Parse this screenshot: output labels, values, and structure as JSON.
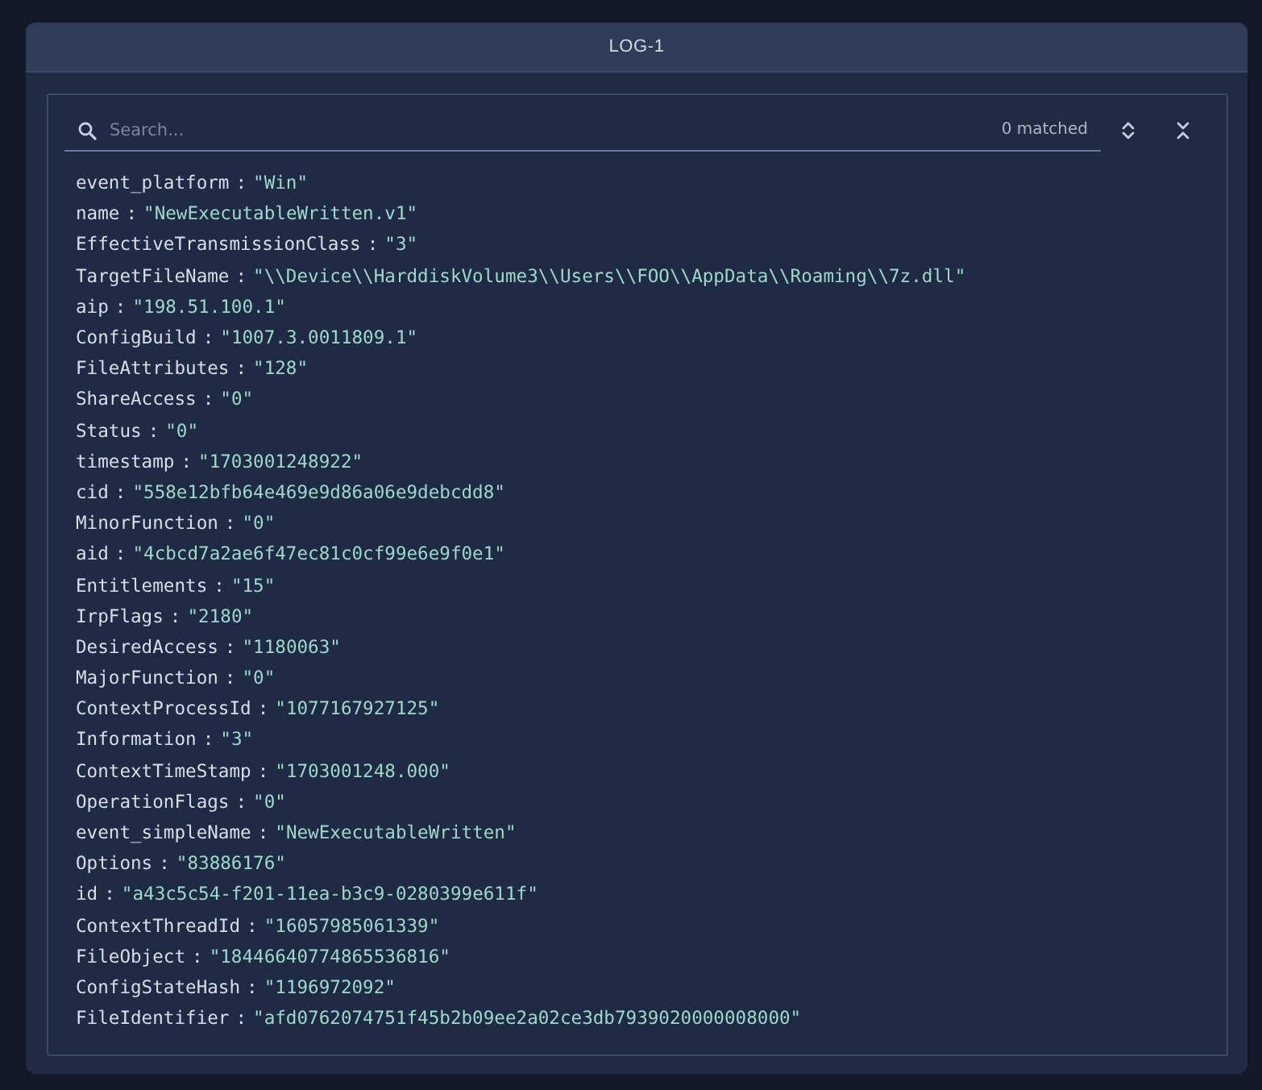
{
  "panel": {
    "title": "LOG-1"
  },
  "search": {
    "placeholder": "Search...",
    "match_count": "0 matched"
  },
  "fields": [
    {
      "key": "event_platform",
      "sep": ":",
      "value": "\"Win\""
    },
    {
      "key": "name",
      "sep": ":",
      "value": "\"NewExecutableWritten.v1\""
    },
    {
      "key": "EffectiveTransmissionClass",
      "sep": ":",
      "value": "\"3\""
    },
    {
      "key": "TargetFileName",
      "sep": ":",
      "value": "\"\\\\Device\\\\HarddiskVolume3\\\\Users\\\\FOO\\\\AppData\\\\Roaming\\\\7z.dll\""
    },
    {
      "key": "aip",
      "sep": ":",
      "value": "\"198.51.100.1\""
    },
    {
      "key": "ConfigBuild",
      "sep": ":",
      "value": "\"1007.3.0011809.1\""
    },
    {
      "key": "FileAttributes",
      "sep": ":",
      "value": "\"128\""
    },
    {
      "key": "ShareAccess",
      "sep": ":",
      "value": "\"0\""
    },
    {
      "key": "Status",
      "sep": ":",
      "value": "\"0\""
    },
    {
      "key": "timestamp",
      "sep": ":",
      "value": "\"1703001248922\""
    },
    {
      "key": "cid",
      "sep": ":",
      "value": "\"558e12bfb64e469e9d86a06e9debcdd8\""
    },
    {
      "key": "MinorFunction",
      "sep": ":",
      "value": "\"0\""
    },
    {
      "key": "aid",
      "sep": ":",
      "value": "\"4cbcd7a2ae6f47ec81c0cf99e6e9f0e1\""
    },
    {
      "key": "Entitlements",
      "sep": ":",
      "value": "\"15\""
    },
    {
      "key": "IrpFlags",
      "sep": ":",
      "value": "\"2180\""
    },
    {
      "key": "DesiredAccess",
      "sep": ":",
      "value": "\"1180063\""
    },
    {
      "key": "MajorFunction",
      "sep": ":",
      "value": "\"0\""
    },
    {
      "key": "ContextProcessId",
      "sep": ":",
      "value": "\"1077167927125\""
    },
    {
      "key": "Information",
      "sep": ":",
      "value": "\"3\""
    },
    {
      "key": "ContextTimeStamp",
      "sep": ":",
      "value": "\"1703001248.000\""
    },
    {
      "key": "OperationFlags",
      "sep": ":",
      "value": "\"0\""
    },
    {
      "key": "event_simpleName",
      "sep": ":",
      "value": "\"NewExecutableWritten\""
    },
    {
      "key": "Options",
      "sep": ":",
      "value": "\"83886176\""
    },
    {
      "key": "id",
      "sep": ":",
      "value": "\"a43c5c54-f201-11ea-b3c9-0280399e611f\""
    },
    {
      "key": "ContextThreadId",
      "sep": ":",
      "value": "\"16057985061339\""
    },
    {
      "key": "FileObject",
      "sep": ":",
      "value": "\"18446640774865536816\""
    },
    {
      "key": "ConfigStateHash",
      "sep": ":",
      "value": "\"1196972092\""
    },
    {
      "key": "FileIdentifier",
      "sep": ":",
      "value": "\"afd0762074751f45b2b09ee2a02ce3db7939020000008000\""
    }
  ]
}
